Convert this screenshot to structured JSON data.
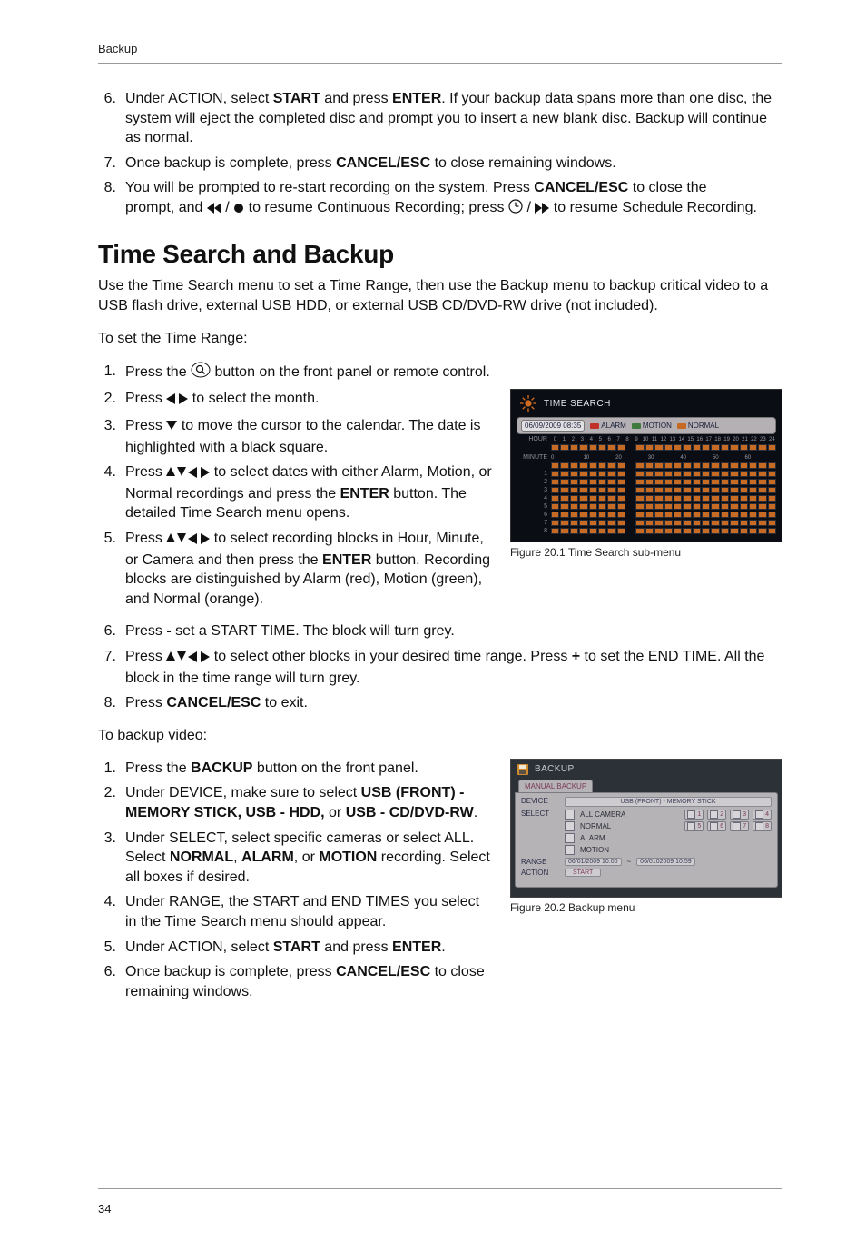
{
  "header": {
    "running": "Backup"
  },
  "footer": {
    "page": "34"
  },
  "top_list": [
    {
      "n": "6.",
      "before": "Under ACTION, select ",
      "b1": "START",
      "mid1": " and press ",
      "b2": "ENTER",
      "after": ". If your backup data spans more than one disc, the system will eject the completed disc and prompt you to insert a new blank disc. Backup will continue as normal."
    },
    {
      "n": "7.",
      "before": "Once backup is complete, press ",
      "b1": "CANCEL/ESC",
      "after": " to close remaining windows."
    },
    {
      "n": "8.",
      "line1_before": "You will be prompted to re-start recording on the system. Press ",
      "line1_b": "CANCEL/ESC",
      "line1_after": " to close the",
      "line2_before": "prompt, and ",
      "line2_mid": " to resume Continuous Recording; press ",
      "line2_after": " to resume Schedule Recording."
    }
  ],
  "section_title": "Time Search and Backup",
  "section_intro": "Use the Time Search menu to set a Time Range, then use the Backup menu to backup critical video to a USB flash drive, external USB HDD, or external USB CD/DVD-RW drive (not included).",
  "set_range_label": "To set the Time Range:",
  "range_list": {
    "items": [
      {
        "n": "1.",
        "before": "Press the ",
        "after": " button on the front panel or remote control."
      },
      {
        "n": "2.",
        "before": "Press ",
        "after": " to select the month."
      },
      {
        "n": "3.",
        "before": "Press",
        "after": " to move the cursor to the calendar. The date is highlighted with a black square."
      },
      {
        "n": "4.",
        "before": "Press ",
        "mid": " to select dates with either Alarm, Motion, or Normal recordings and press the ",
        "b": "ENTER",
        "after": " button. The detailed Time Search menu opens."
      },
      {
        "n": "5.",
        "before": "Press ",
        "mid": " to select recording blocks in Hour, Minute, or Camera and then press the ",
        "b": "ENTER",
        "after": " button. Recording blocks are distinguished by Alarm (red), Motion (green), and Normal (orange)."
      }
    ]
  },
  "range_list_tail": [
    {
      "n": "6.",
      "before": "Press ",
      "bold": "-",
      "after": " set a START TIME. The block will turn grey."
    },
    {
      "n": "7.",
      "before": "Press ",
      "mid": " to select other blocks in your desired time range. Press ",
      "bold": "+",
      "after": " to set the END TIME. All the block in the time range will turn grey."
    },
    {
      "n": "8.",
      "before": "Press ",
      "bold": "CANCEL/ESC",
      "after": " to exit."
    }
  ],
  "backup_label": "To backup video:",
  "backup_list": [
    {
      "n": "1.",
      "before": "Press the ",
      "b1": "BACKUP",
      "after": " button on the front panel."
    },
    {
      "n": "2.",
      "before": "Under DEVICE, make sure to select ",
      "b1": "USB (FRONT) - MEMORY STICK, USB - HDD,",
      "mid": " or ",
      "b2": "USB - CD/DVD-RW",
      "after": "."
    },
    {
      "n": "3.",
      "before": "Under SELECT, select specific cameras or select ALL. Select ",
      "b1": "NORMAL",
      "mid1": ", ",
      "b2": "ALARM",
      "mid2": ", or ",
      "b3": "MOTION",
      "after": " recording. Select all boxes if desired."
    },
    {
      "n": "4.",
      "text": "Under RANGE, the START and END TIMES you select in the Time Search menu should appear."
    },
    {
      "n": "5.",
      "before": "Under ACTION, select ",
      "b1": "START",
      "mid": " and press ",
      "b2": "ENTER",
      "after": "."
    },
    {
      "n": "6.",
      "before": "Once backup is complete, press ",
      "b1": "CANCEL/ESC",
      "after": " to close remaining windows."
    }
  ],
  "fig1": {
    "title": "TIME SEARCH",
    "date": "06/09/2009 08:35",
    "legend": {
      "alarm": "ALARM",
      "motion": "MOTION",
      "normal": "NORMAL"
    },
    "hour_label": "HOUR",
    "minute_label": "MINUTE",
    "hours": [
      "0",
      "1",
      "2",
      "3",
      "4",
      "5",
      "6",
      "7",
      "8",
      "9",
      "10",
      "11",
      "12",
      "13",
      "14",
      "15",
      "16",
      "17",
      "18",
      "19",
      "20",
      "21",
      "22",
      "23",
      "24"
    ],
    "minutes": [
      "0",
      "10",
      "20",
      "30",
      "40",
      "50",
      "60"
    ],
    "rows": [
      "1",
      "2",
      "3",
      "4",
      "5",
      "6",
      "7",
      "8"
    ],
    "caption": "Figure 20.1 Time Search sub-menu"
  },
  "fig2": {
    "title": "BACKUP",
    "tab": "MANUAL BACKUP",
    "device_label": "DEVICE",
    "device_value": "USB (FRONT) - MEMORY STICK",
    "select_label": "SELECT",
    "select_all": "ALL CAMERA",
    "select_normal": "NORMAL",
    "select_alarm": "ALARM",
    "select_motion": "MOTION",
    "cams_row1": [
      "1",
      "2",
      "3",
      "4"
    ],
    "cams_row2": [
      "5",
      "6",
      "7",
      "8"
    ],
    "range_label": "RANGE",
    "range_start": "06/01/2009 10:00",
    "range_sep": "~",
    "range_end": "06/0102009 10:59",
    "action_label": "ACTION",
    "action_btn": "START",
    "caption": "Figure 20.2 Backup menu"
  }
}
